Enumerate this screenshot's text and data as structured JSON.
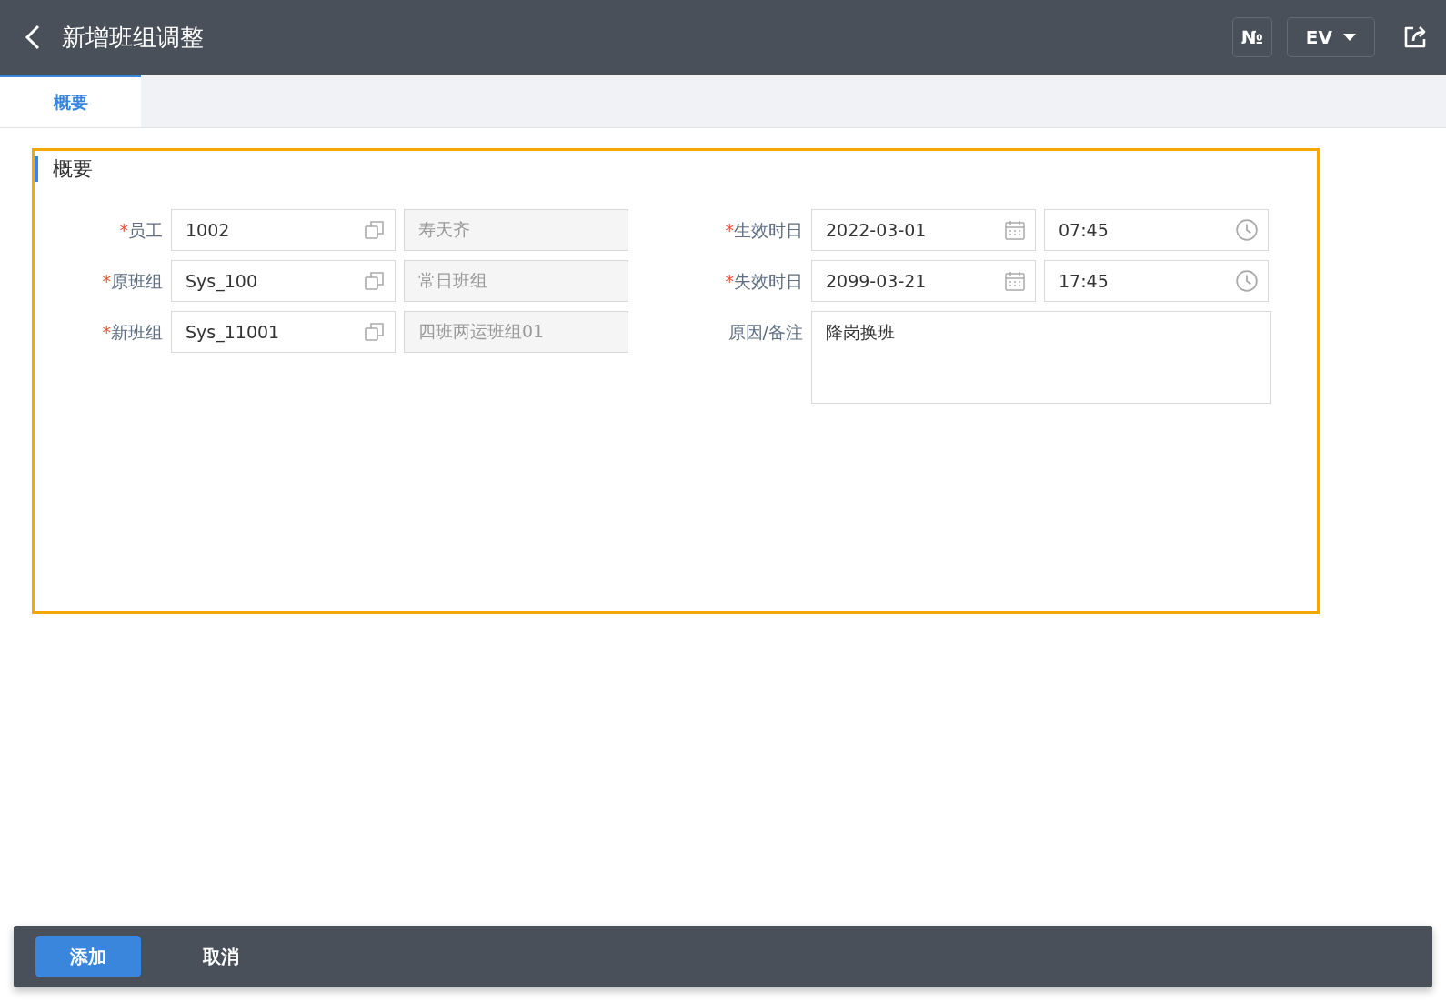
{
  "header": {
    "title": "新增班组调整",
    "number_button": "№",
    "language_button": "EV"
  },
  "tabs": [
    {
      "label": "概要",
      "selected": true
    }
  ],
  "section": {
    "title": "概要",
    "left_fields": [
      {
        "kind": "lookup",
        "required_mark": "*",
        "label": "员工",
        "value": "1002",
        "description": "寿天齐"
      },
      {
        "kind": "lookup",
        "required_mark": "*",
        "label": "原班组",
        "value": "Sys_100",
        "description": "常日班组"
      },
      {
        "kind": "lookup",
        "required_mark": "*",
        "label": "新班组",
        "value": "Sys_11001",
        "description": "四班两运班组01"
      }
    ],
    "right_fields": [
      {
        "kind": "datetime",
        "required_mark": "*",
        "label": "生效时日",
        "date": "2022-03-01",
        "time": "07:45"
      },
      {
        "kind": "datetime",
        "required_mark": "*",
        "label": "失效时日",
        "date": "2099-03-21",
        "time": "17:45"
      },
      {
        "kind": "textarea",
        "label": "原因/备注",
        "value": "降岗换班"
      }
    ]
  },
  "footer": {
    "buttons": [
      {
        "label": "添加",
        "kind": "primary"
      },
      {
        "label": "取消",
        "kind": "plain"
      }
    ]
  }
}
